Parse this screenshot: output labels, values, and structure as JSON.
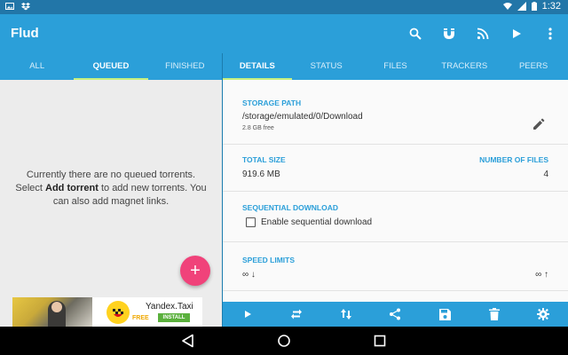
{
  "status_bar": {
    "time": "1:32"
  },
  "app_bar": {
    "title": "Flud",
    "actions": [
      "search-icon",
      "magnet-icon",
      "rss-icon",
      "play-icon",
      "overflow-menu-icon"
    ]
  },
  "left_tabs": [
    "ALL",
    "QUEUED",
    "FINISHED"
  ],
  "left_active_tab": "QUEUED",
  "empty_state": {
    "line1": "Currently there are no queued torrents.",
    "line2_pre": "Select ",
    "line2_bold": "Add torrent",
    "line2_post": " to add new torrents. You",
    "line3": "can also add magnet links."
  },
  "fab": {
    "label": "+"
  },
  "ad": {
    "name": "Yandex.Taxi",
    "free": "FREE",
    "install": "INSTALL"
  },
  "right_tabs": [
    "DETAILS",
    "STATUS",
    "FILES",
    "TRACKERS",
    "PEERS"
  ],
  "right_active_tab": "DETAILS",
  "details": {
    "storage_path_label": "STORAGE PATH",
    "storage_path": "/storage/emulated/0/Download",
    "storage_free": "2.8 GB free",
    "total_size_label": "TOTAL SIZE",
    "total_size": "919.6 MB",
    "num_files_label": "NUMBER OF FILES",
    "num_files": "4",
    "sequential_label": "SEQUENTIAL DOWNLOAD",
    "sequential_checkbox": "Enable sequential download",
    "sequential_checked": false,
    "speed_label": "SPEED LIMITS",
    "speed_down": "∞ ↓",
    "speed_up": "∞ ↑"
  },
  "bottom_actions": [
    "play-icon",
    "repeat-icon",
    "sort-arrows-icon",
    "share-icon",
    "save-icon",
    "delete-icon",
    "settings-icon"
  ],
  "colors": {
    "primary": "#2b9fd9",
    "status_bar": "#2276a8",
    "accent": "#f0427a",
    "tab_indicator": "#c8f080"
  }
}
